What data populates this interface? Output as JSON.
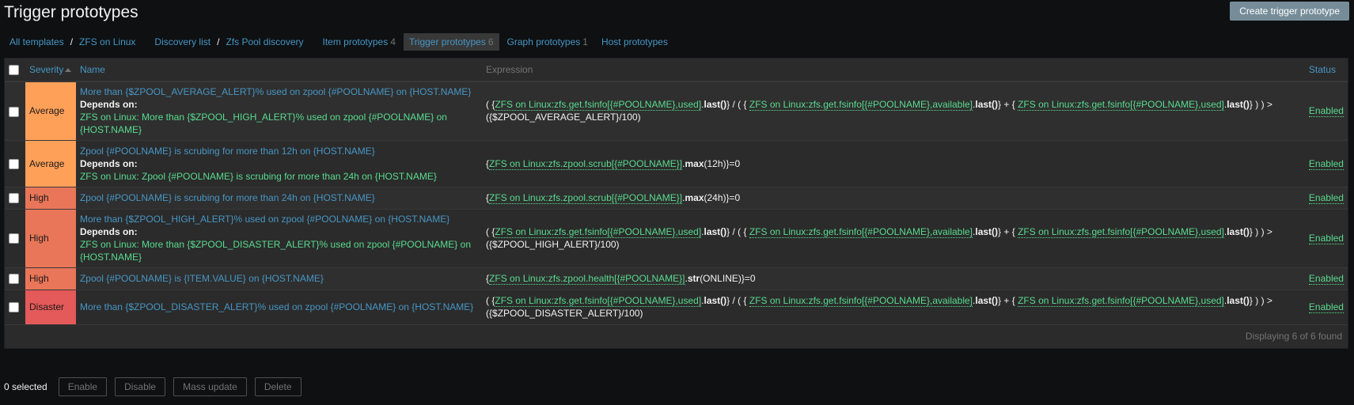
{
  "page": {
    "title": "Trigger prototypes",
    "create_label": "Create trigger prototype"
  },
  "nav": {
    "all_templates": "All templates",
    "template": "ZFS on Linux",
    "discovery_list": "Discovery list",
    "discovery_rule": "Zfs Pool discovery",
    "tabs": [
      {
        "label": "Item prototypes",
        "count": "4"
      },
      {
        "label": "Trigger prototypes",
        "count": "6"
      },
      {
        "label": "Graph prototypes",
        "count": "1"
      },
      {
        "label": "Host prototypes",
        "count": ""
      }
    ]
  },
  "table": {
    "headers": {
      "severity": "Severity",
      "name": "Name",
      "expression": "Expression",
      "status": "Status"
    },
    "depends_label": "Depends on:",
    "rows": [
      {
        "severity": "Average",
        "name": "More than {$ZPOOL_AVERAGE_ALERT}% used on zpool {#POOLNAME} on {HOST.NAME}",
        "depends": "ZFS on Linux: More than {$ZPOOL_HIGH_ALERT}% used on zpool {#POOLNAME} on {HOST.NAME}",
        "expr": {
          "p1": "( {",
          "f1": "ZFS on Linux:zfs.get.fsinfo[{#POOLNAME},used]",
          "p2": ".",
          "m1": "last()",
          "p3": "} / ( {",
          "f2": "ZFS on Linux:zfs.get.fsinfo[{#POOLNAME},available]",
          "p4": ".",
          "m2": "last()",
          "p5": "} + {",
          "f3": "ZFS on Linux:zfs.get.fsinfo[{#POOLNAME},used]",
          "p6": ".",
          "m3": "last()",
          "p7": "} ) ) > ({$ZPOOL_AVERAGE_ALERT}/100)"
        },
        "status": "Enabled"
      },
      {
        "severity": "Average",
        "name": "Zpool {#POOLNAME} is scrubing for more than 12h on {HOST.NAME}",
        "depends": "ZFS on Linux: Zpool {#POOLNAME} is scrubing for more than 24h on {HOST.NAME}",
        "expr": {
          "p1": "{",
          "f1": "ZFS on Linux:zfs.zpool.scrub[{#POOLNAME}]",
          "p2": ".",
          "m1": "max",
          "p3": "(12h)}=0"
        },
        "status": "Enabled"
      },
      {
        "severity": "High",
        "name": "Zpool {#POOLNAME} is scrubing for more than 24h on {HOST.NAME}",
        "expr": {
          "p1": "{",
          "f1": "ZFS on Linux:zfs.zpool.scrub[{#POOLNAME}]",
          "p2": ".",
          "m1": "max",
          "p3": "(24h)}=0"
        },
        "status": "Enabled"
      },
      {
        "severity": "High",
        "name": "More than {$ZPOOL_HIGH_ALERT}% used on zpool {#POOLNAME} on {HOST.NAME}",
        "depends": "ZFS on Linux: More than {$ZPOOL_DISASTER_ALERT}% used on zpool {#POOLNAME} on {HOST.NAME}",
        "expr": {
          "p1": "( {",
          "f1": "ZFS on Linux:zfs.get.fsinfo[{#POOLNAME},used]",
          "p2": ".",
          "m1": "last()",
          "p3": "} / ( {",
          "f2": "ZFS on Linux:zfs.get.fsinfo[{#POOLNAME},available]",
          "p4": ".",
          "m2": "last()",
          "p5": "} + {",
          "f3": "ZFS on Linux:zfs.get.fsinfo[{#POOLNAME},used]",
          "p6": ".",
          "m3": "last()",
          "p7": "} ) ) > ({$ZPOOL_HIGH_ALERT}/100)"
        },
        "status": "Enabled"
      },
      {
        "severity": "High",
        "name": "Zpool {#POOLNAME} is {ITEM.VALUE} on {HOST.NAME}",
        "expr": {
          "p1": "{",
          "f1": "ZFS on Linux:zfs.zpool.health[{#POOLNAME}]",
          "p2": ".",
          "m1": "str",
          "p3": "(ONLINE)}=0"
        },
        "status": "Enabled"
      },
      {
        "severity": "Disaster",
        "name": "More than {$ZPOOL_DISASTER_ALERT}% used on zpool {#POOLNAME} on {HOST.NAME}",
        "expr": {
          "p1": "( {",
          "f1": "ZFS on Linux:zfs.get.fsinfo[{#POOLNAME},used]",
          "p2": ".",
          "m1": "last()",
          "p3": "} / ( {",
          "f2": "ZFS on Linux:zfs.get.fsinfo[{#POOLNAME},available]",
          "p4": ".",
          "m2": "last()",
          "p5": "} + {",
          "f3": "ZFS on Linux:zfs.get.fsinfo[{#POOLNAME},used]",
          "p6": ".",
          "m3": "last()",
          "p7": "} ) ) > ({$ZPOOL_DISASTER_ALERT}/100)"
        },
        "status": "Enabled"
      }
    ],
    "footer": "Displaying 6 of 6 found"
  },
  "actions": {
    "selected": "0 selected",
    "enable": "Enable",
    "disable": "Disable",
    "mass_update": "Mass update",
    "delete": "Delete"
  },
  "colors": {
    "average": "#ffa059",
    "high": "#e97659",
    "disaster": "#e45959",
    "link": "#4796c4",
    "green": "#59db8f"
  }
}
